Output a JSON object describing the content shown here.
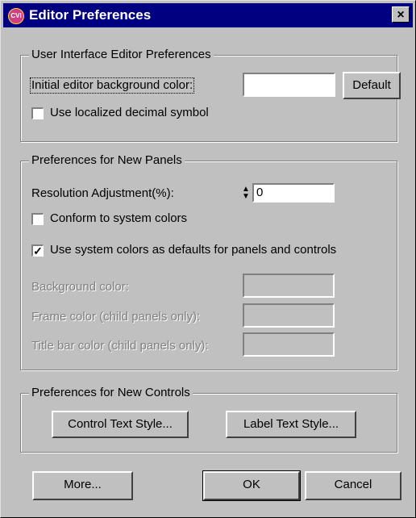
{
  "window": {
    "app_icon_text": "CVI",
    "title": "Editor Preferences",
    "close_label": "×"
  },
  "ui_editor_group": {
    "title": "User Interface Editor Preferences",
    "bg_color_label": "Initial editor background color:",
    "bg_color_value": "",
    "default_button": "Default",
    "localized_decimal_label": "Use localized decimal symbol",
    "localized_decimal_checked": false
  },
  "new_panels_group": {
    "title": "Preferences for New Panels",
    "resolution_label": "Resolution Adjustment(%):",
    "resolution_value": "0",
    "conform_label": "Conform to system colors",
    "conform_checked": false,
    "use_system_colors_label": "Use system colors as defaults for panels and controls",
    "use_system_colors_checked": true,
    "background_color_label": "Background color:",
    "frame_color_label": "Frame color (child panels only):",
    "title_bar_color_label": "Title bar color (child panels only):"
  },
  "new_controls_group": {
    "title": "Preferences for New Controls",
    "control_text_style_button": "Control Text Style...",
    "label_text_style_button": "Label Text Style..."
  },
  "footer": {
    "more_button": "More...",
    "ok_button": "OK",
    "cancel_button": "Cancel"
  },
  "colors": {
    "title_bar": "#000080",
    "dialog_face": "#c0c0c0"
  }
}
